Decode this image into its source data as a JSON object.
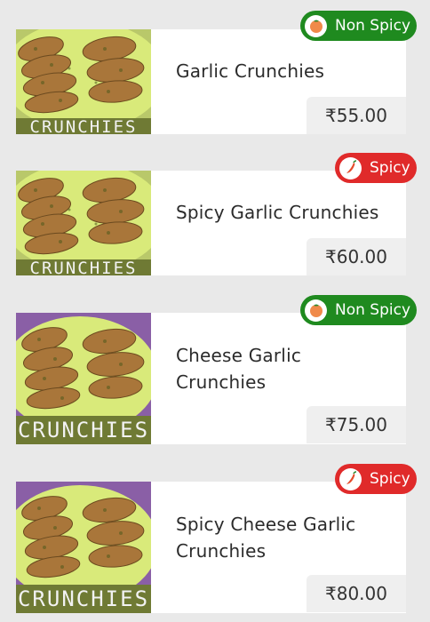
{
  "items": [
    {
      "name": "Garlic Crunchies",
      "price": "₹55.00",
      "tag": "Non Spicy",
      "tag_type": "non-spicy",
      "image_icon": "garlic-bread-photo",
      "caption_visible": "partial"
    },
    {
      "name": "Spicy Garlic Crunchies",
      "price": "₹60.00",
      "tag": "Spicy",
      "tag_type": "spicy",
      "image_icon": "garlic-bread-photo",
      "caption_visible": "partial"
    },
    {
      "name": "Cheese Garlic Crunchies",
      "price": "₹75.00",
      "tag": "Non Spicy",
      "tag_type": "non-spicy",
      "image_icon": "garlic-bread-photo",
      "caption_visible": "full"
    },
    {
      "name": "Spicy Cheese Garlic Crunchies",
      "price": "₹80.00",
      "tag": "Spicy",
      "tag_type": "spicy",
      "image_icon": "garlic-bread-photo",
      "caption_visible": "full"
    }
  ],
  "image_caption": "CRUNCHIES",
  "colors": {
    "non_spicy": "#1f8a1f",
    "spicy": "#e02a2a",
    "price_bg": "#efefef",
    "page_bg": "#e9e9e9"
  }
}
